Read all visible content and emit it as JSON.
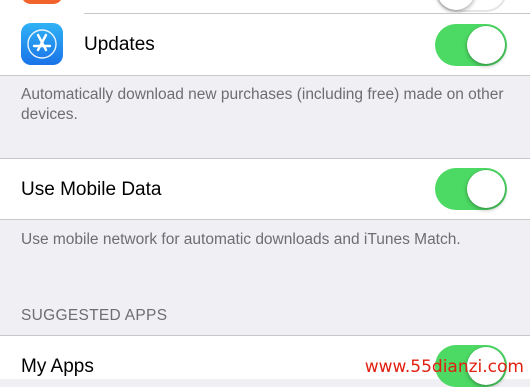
{
  "rows": {
    "updates": {
      "label": "Updates",
      "toggle_on": true,
      "icon": "app-store-icon"
    },
    "mobile_data": {
      "label": "Use Mobile Data",
      "toggle_on": true
    },
    "my_apps": {
      "label": "My Apps",
      "toggle_on": true
    }
  },
  "footers": {
    "updates_note": "Automatically download new purchases (including free) made on other devices.",
    "mobile_note": "Use mobile network for automatic downloads and iTunes Match."
  },
  "section_headers": {
    "suggested_apps": "SUGGESTED APPS"
  },
  "watermark": "www.55dianzi.com",
  "colors": {
    "toggle_on": "#4cd964",
    "background": "#efeff4",
    "footer_text": "#6d6d72"
  }
}
